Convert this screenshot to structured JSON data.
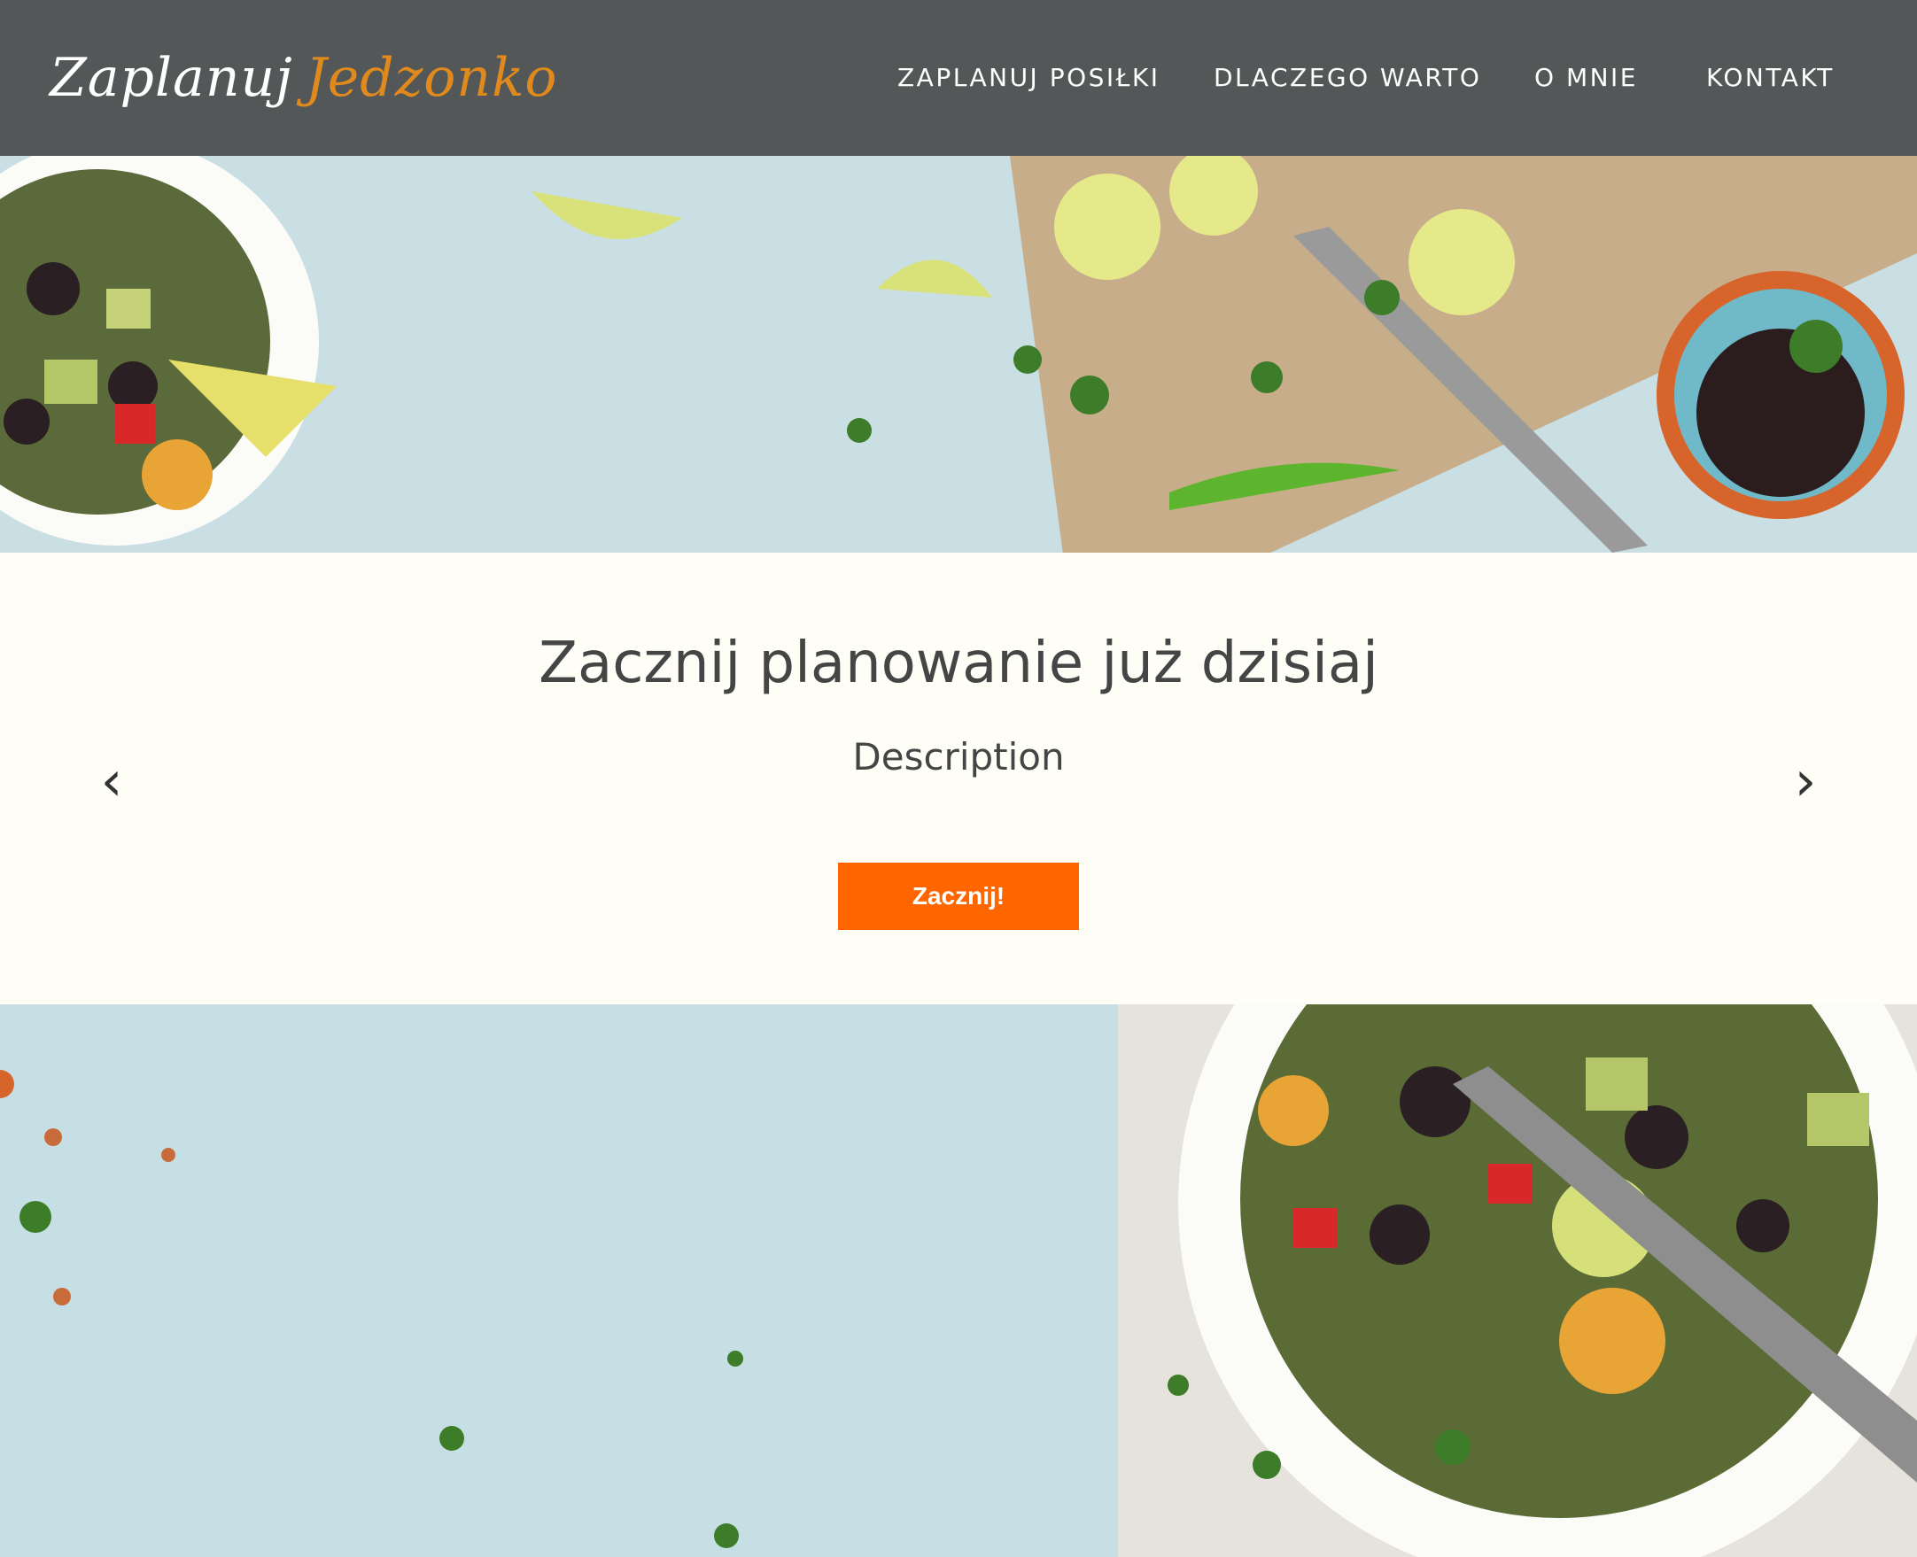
{
  "brand": {
    "logo_word1": "Zaplanuj",
    "logo_word2": "Jedzonko",
    "accent_color": "#e08a1e"
  },
  "nav": {
    "items": [
      {
        "label": "ZAPLANUJ POSIŁKI"
      },
      {
        "label": "DLACZEGO WARTO"
      },
      {
        "label": "O MNIE"
      },
      {
        "label": "KONTAKT"
      }
    ]
  },
  "carousel": {
    "title": "Zacznij planowanie już dzisiaj",
    "description": "Description",
    "prev_icon": "‹",
    "next_icon": "›",
    "cta_label": "Zacznij!",
    "cta_color": "#ff6600"
  },
  "colors": {
    "header_bg": "#545757",
    "page_bg": "#fefef7",
    "text": "#454545"
  }
}
